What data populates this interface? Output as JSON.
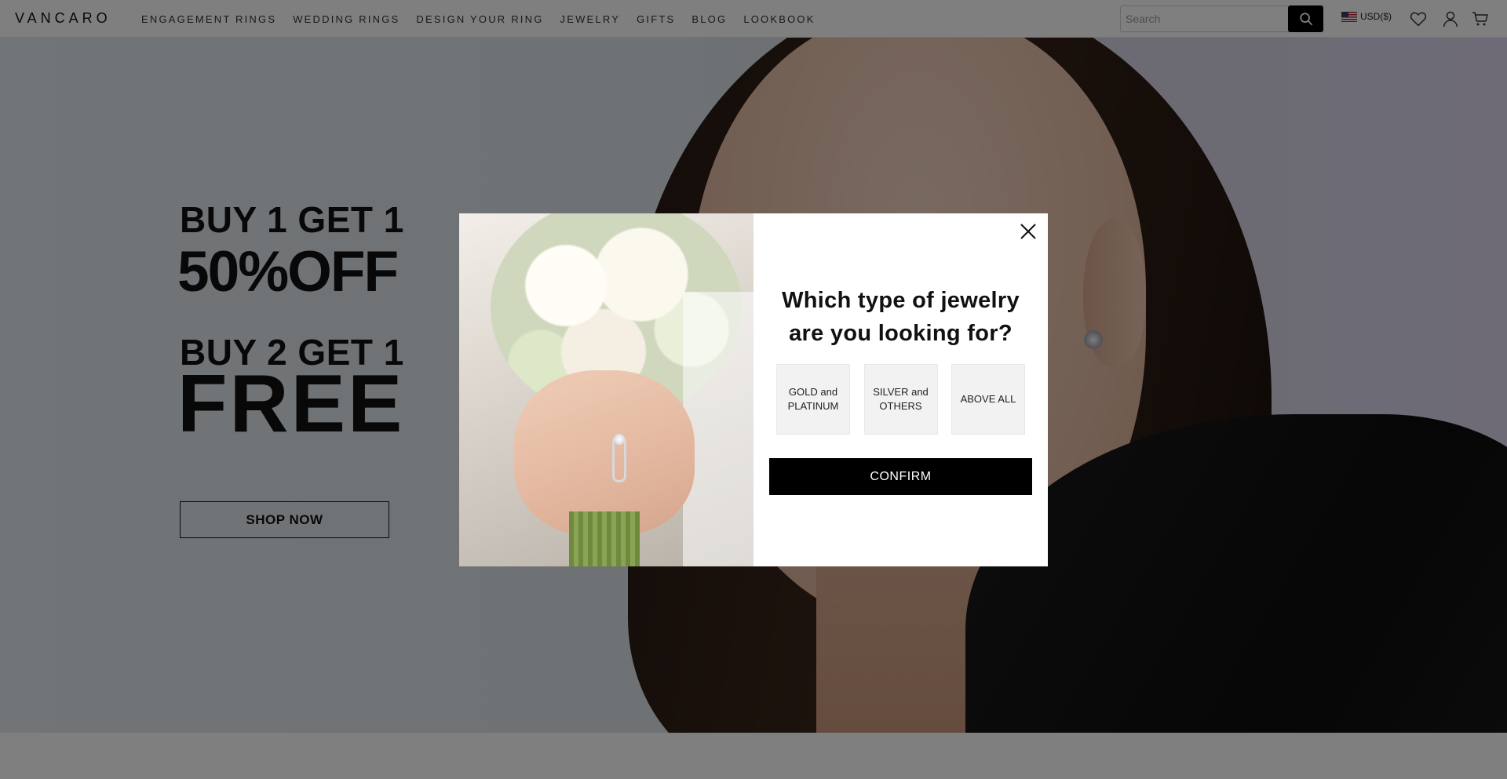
{
  "header": {
    "logo": "VANCARO",
    "nav": [
      {
        "label": "ENGAGEMENT RINGS"
      },
      {
        "label": "WEDDING RINGS"
      },
      {
        "label": "DESIGN YOUR RING"
      },
      {
        "label": "JEWELRY"
      },
      {
        "label": "GIFTS"
      },
      {
        "label": "BLOG"
      },
      {
        "label": "LOOKBOOK"
      }
    ],
    "search": {
      "placeholder": "Search",
      "value": "",
      "icon": "search-icon"
    },
    "currency": {
      "label": "USD($)",
      "flag": "us-flag-icon"
    },
    "icons": [
      "heart-icon",
      "user-icon",
      "cart-icon"
    ]
  },
  "hero": {
    "line1": "BUY 1 GET 1",
    "line2": "50%OFF",
    "line3": "BUY 2 GET 1",
    "line4": "FREE",
    "cta_label": "SHOP NOW",
    "earring_icon": "earring-image"
  },
  "modal": {
    "title": "Which type of jewelry are you looking for?",
    "options": [
      {
        "label": "GOLD and PLATINUM"
      },
      {
        "label": "SILVER and OTHERS"
      },
      {
        "label": "ABOVE ALL"
      }
    ],
    "confirm_label": "CONFIRM",
    "close_icon": "close-icon"
  },
  "colors": {
    "overlay": "#000000",
    "confirm_bg": "#000000",
    "option_bg": "#f2f2f2",
    "search_button": "#000000"
  }
}
